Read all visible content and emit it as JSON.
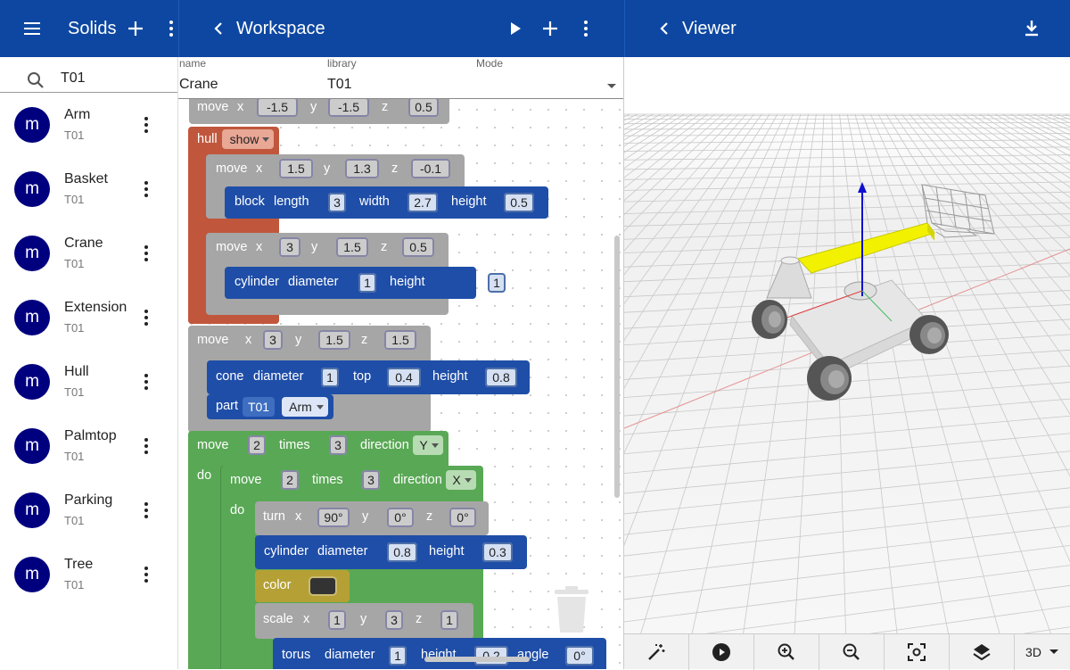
{
  "solids": {
    "title": "Solids",
    "search_value": "T01",
    "items": [
      {
        "avatar": "m",
        "name": "Arm",
        "library": "T01"
      },
      {
        "avatar": "m",
        "name": "Basket",
        "library": "T01"
      },
      {
        "avatar": "m",
        "name": "Crane",
        "library": "T01"
      },
      {
        "avatar": "m",
        "name": "Extension",
        "library": "T01"
      },
      {
        "avatar": "m",
        "name": "Hull",
        "library": "T01"
      },
      {
        "avatar": "m",
        "name": "Palmtop",
        "library": "T01"
      },
      {
        "avatar": "m",
        "name": "Parking",
        "library": "T01"
      },
      {
        "avatar": "m",
        "name": "Tree",
        "library": "T01"
      }
    ]
  },
  "workspace": {
    "title": "Workspace",
    "fields": {
      "name_label": "name",
      "name_value": "Crane",
      "library_label": "library",
      "library_value": "T01",
      "mode_label": "Mode"
    },
    "blocks": {
      "kw": {
        "move": "move",
        "x": "x",
        "y": "y",
        "z": "z",
        "hull": "hull",
        "block": "block",
        "length": "length",
        "width": "width",
        "height": "height",
        "cylinder": "cylinder",
        "diameter": "diameter",
        "cone": "cone",
        "top": "top",
        "part": "part",
        "times": "times",
        "direction": "direction",
        "do": "do",
        "turn": "turn",
        "color": "color",
        "scale": "scale",
        "torus": "torus",
        "angle": "angle"
      },
      "move1": {
        "x": "-1.5",
        "y": "-1.5",
        "z": "0.5"
      },
      "hull_mode": "show",
      "move2": {
        "x": "1.5",
        "y": "1.3",
        "z": "-0.1"
      },
      "block1": {
        "length": "3",
        "width": "2.7",
        "height": "0.5"
      },
      "move3": {
        "x": "3",
        "y": "1.5",
        "z": "0.5"
      },
      "cyl1": {
        "diameter": "1",
        "height": "1"
      },
      "move4": {
        "x": "3",
        "y": "1.5",
        "z": "1.5"
      },
      "cone1": {
        "diameter": "1",
        "top": "0.4",
        "height": "0.8"
      },
      "part1": {
        "library": "T01",
        "name": "Arm"
      },
      "rep1": {
        "move": "2",
        "times": "3",
        "direction": "Y"
      },
      "rep2": {
        "move": "2",
        "times": "3",
        "direction": "X"
      },
      "turn1": {
        "x": "90°",
        "y": "0°",
        "z": "0°"
      },
      "cyl2": {
        "diameter": "0.8",
        "height": "0.3"
      },
      "color1": {
        "swatch": "#333333"
      },
      "scale1": {
        "x": "1",
        "y": "3",
        "z": "1"
      },
      "torus1": {
        "diameter": "1",
        "height": "0.2",
        "angle": "0°"
      }
    }
  },
  "viewer": {
    "title": "Viewer",
    "toolbar": {
      "mode_value": "3D"
    },
    "colors": {
      "arm": "#f2f200",
      "axis_z": "#1010d0",
      "axis_x": "#e04040",
      "axis_y": "#40c060"
    }
  },
  "icons": [
    "menu-icon",
    "add-icon",
    "more-vert-icon",
    "back-icon",
    "play-icon",
    "download-icon",
    "search-icon",
    "wand-icon",
    "zoom-in-icon",
    "zoom-out-icon",
    "fit-icon",
    "layers-icon",
    "dropdown-icon",
    "trash-icon"
  ]
}
